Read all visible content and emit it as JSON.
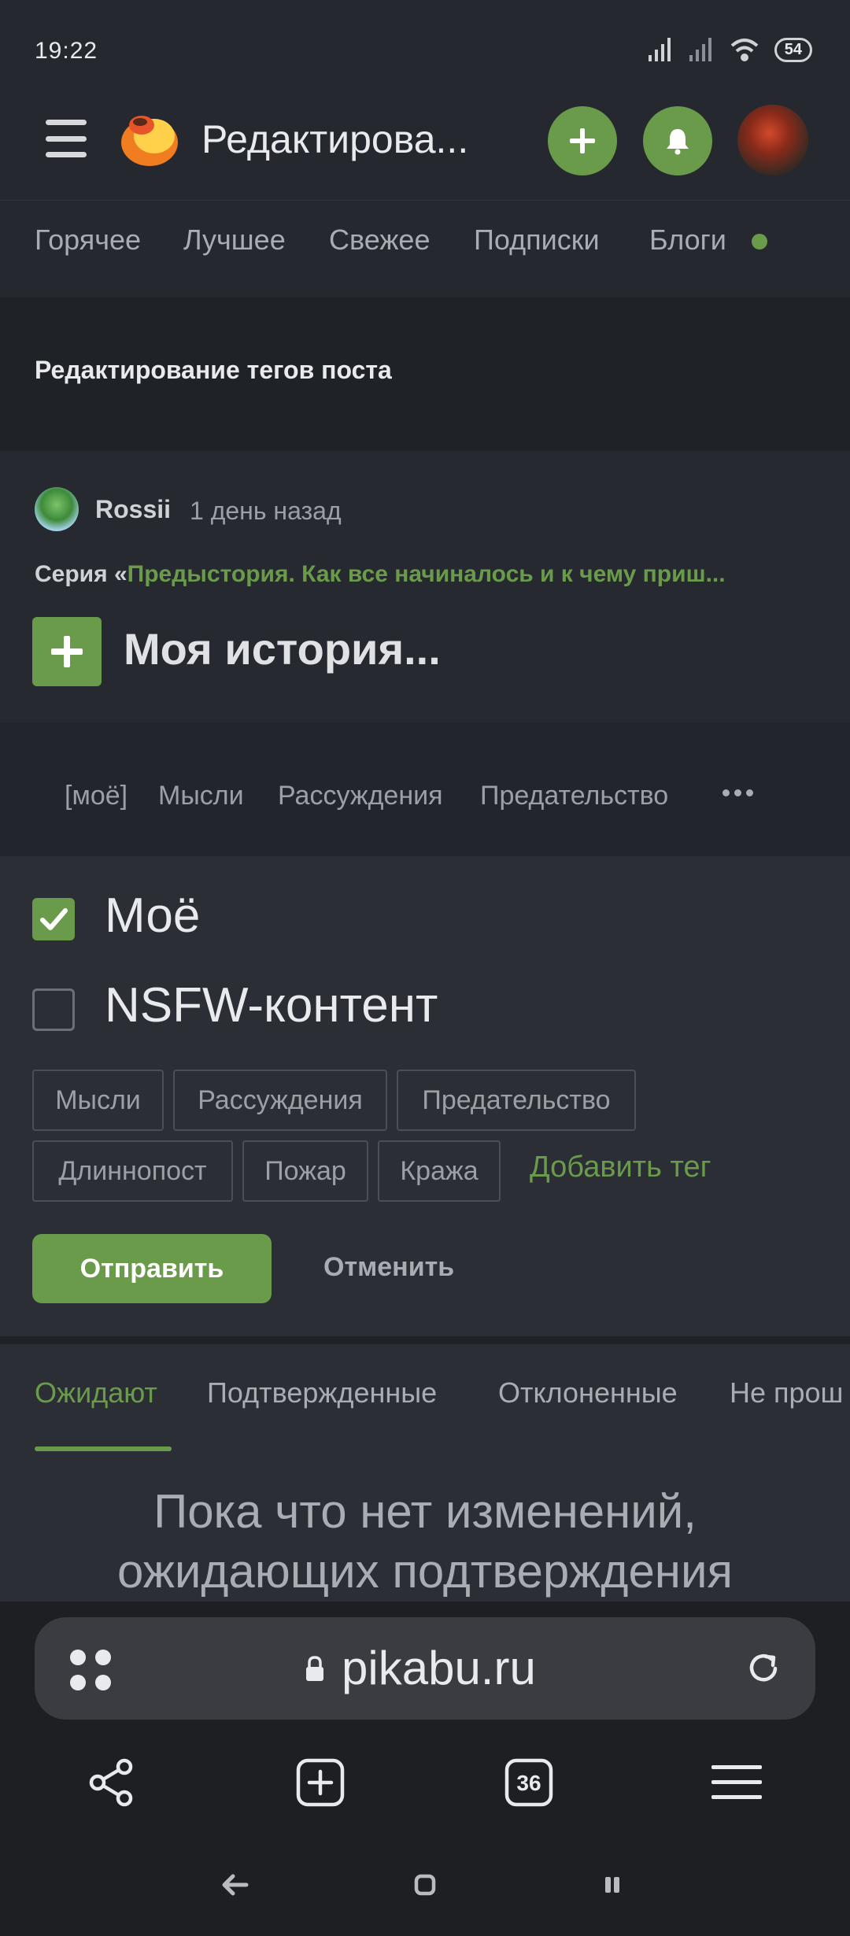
{
  "status_bar": {
    "time": "19:22",
    "battery": "54"
  },
  "header": {
    "title": "Редактирова..."
  },
  "nav": {
    "items": [
      "Горячее",
      "Лучшее",
      "Свежее",
      "Подписки",
      "Блоги"
    ]
  },
  "page": {
    "title": "Редактирование тегов поста"
  },
  "post": {
    "author": "Rossii",
    "time": "1 день назад",
    "series_prefix": "Серия «",
    "series_title": "Предыстория. Как все начиналось и к чему приш...",
    "title": "Моя история..."
  },
  "tag_strip": [
    "[моё]",
    "Мысли",
    "Рассуждения",
    "Предательство"
  ],
  "form": {
    "moe_label": "Моё",
    "moe_checked": true,
    "nsfw_label": "NSFW-контент",
    "nsfw_checked": false,
    "tags": [
      "Мысли",
      "Рассуждения",
      "Предательство",
      "Длиннопост",
      "Пожар",
      "Кража"
    ],
    "add_tag": "Добавить тег",
    "submit": "Отправить",
    "cancel": "Отменить"
  },
  "status_tabs": {
    "items": [
      "Ожидают",
      "Подтвержденные",
      "Отклоненные",
      "Не прош"
    ],
    "active": "Ожидают",
    "empty_message": "Пока что нет изменений, ожидающих подтверждения"
  },
  "browser": {
    "url": "pikabu.ru",
    "tab_count": "36"
  },
  "icons": {
    "menu": "hamburger-icon",
    "logo": "pikabu-logo",
    "add": "plus-icon",
    "notifications": "bell-icon",
    "share": "share-icon",
    "new_tab": "new-tab-icon",
    "tabs": "tabs-count-icon",
    "browser_menu": "menu-icon",
    "reload": "reload-icon",
    "lock": "lock-icon"
  },
  "colors": {
    "accent": "#6a9b4a",
    "background": "#22262c",
    "text": "#e8eaed",
    "muted": "#9aa0a6"
  }
}
